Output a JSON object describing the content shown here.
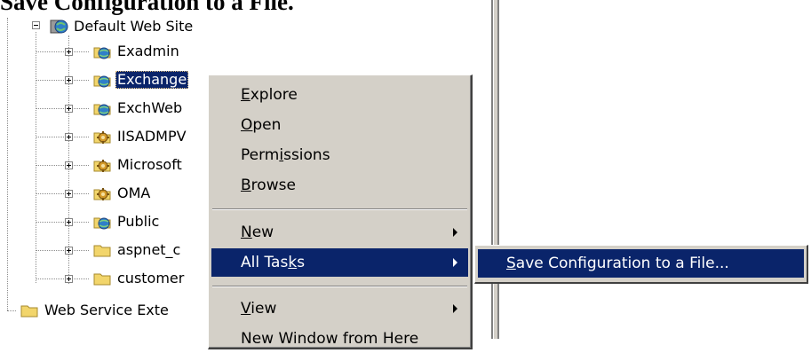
{
  "heading": "Save Configuration to a File.",
  "tree": {
    "root": "Default Web Site",
    "children": [
      {
        "label": "Exadmin",
        "icon": "web-globe-icon"
      },
      {
        "label": "Exchange",
        "icon": "web-globe-icon",
        "selected": true
      },
      {
        "label": "ExchWeb",
        "icon": "web-globe-icon"
      },
      {
        "label": "IISADMPV",
        "icon": "gear-app-icon"
      },
      {
        "label": "Microsoft",
        "icon": "gear-app-icon"
      },
      {
        "label": "OMA",
        "icon": "gear-app-icon"
      },
      {
        "label": "Public",
        "icon": "web-globe-icon"
      },
      {
        "label": "aspnet_c",
        "icon": "folder-icon"
      },
      {
        "label": "customer",
        "icon": "folder-icon"
      }
    ],
    "sibling": "Web Service Exte"
  },
  "menu": {
    "explore": {
      "pre": "",
      "key": "E",
      "post": "xplore"
    },
    "open": {
      "pre": "",
      "key": "O",
      "post": "pen"
    },
    "permissions": {
      "pre": "Perm",
      "key": "i",
      "post": "ssions"
    },
    "browse": {
      "pre": "",
      "key": "B",
      "post": "rowse"
    },
    "new": {
      "pre": "",
      "key": "N",
      "post": "ew"
    },
    "all_tasks": {
      "pre": "All Tas",
      "key": "k",
      "post": "s"
    },
    "view": {
      "pre": "",
      "key": "V",
      "post": "iew"
    },
    "new_window": "New Window from Here"
  },
  "submenu": {
    "save_config": {
      "pre": "",
      "key": "S",
      "post": "ave Configuration to a File..."
    }
  },
  "colors": {
    "selection": "#0a246a",
    "menu_bg": "#d4d0c8"
  }
}
